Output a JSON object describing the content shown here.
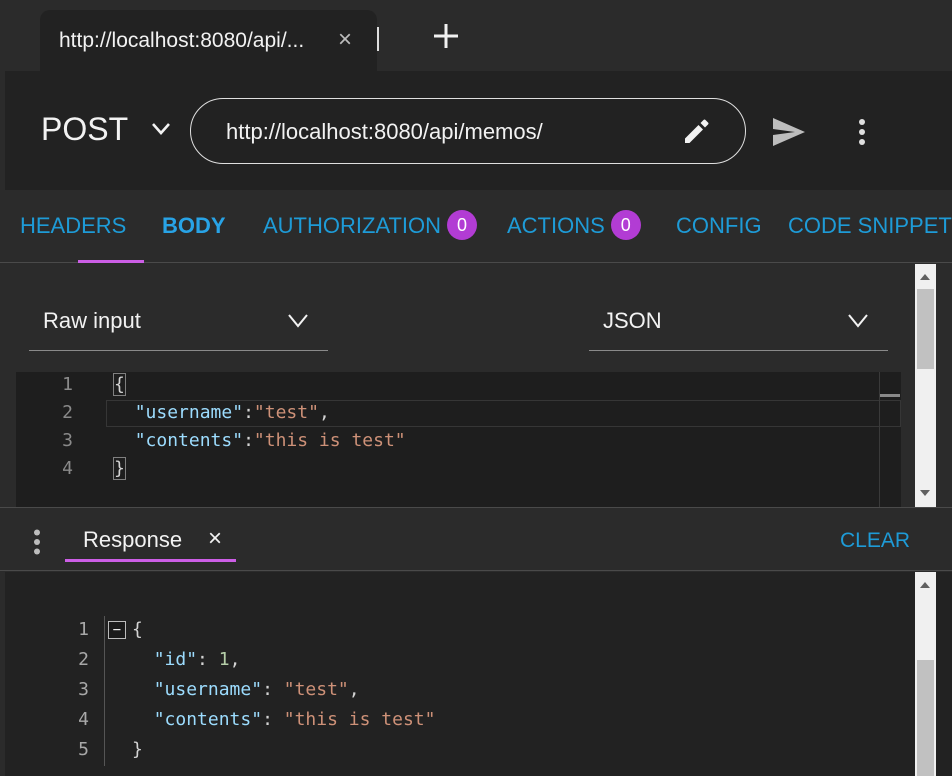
{
  "tab": {
    "title": "http://localhost:8080/api/...",
    "close": "×"
  },
  "request": {
    "method": "POST",
    "url": "http://localhost:8080/api/memos/"
  },
  "section_tabs": [
    {
      "label": "HEADERS"
    },
    {
      "label": "BODY",
      "active": true
    },
    {
      "label": "AUTHORIZATION",
      "badge": "0"
    },
    {
      "label": "ACTIONS",
      "badge": "0"
    },
    {
      "label": "CONFIG"
    },
    {
      "label": "CODE SNIPPET"
    }
  ],
  "body": {
    "input_mode": "Raw input",
    "content_type": "JSON",
    "lines": [
      {
        "num": "1",
        "text": "{"
      },
      {
        "num": "2",
        "key": "\"username\"",
        "sep": ":",
        "value": "\"test\"",
        "tail": ","
      },
      {
        "num": "3",
        "key": "\"contents\"",
        "sep": ":",
        "value": "\"this is test\"",
        "tail": ""
      },
      {
        "num": "4",
        "text": "}"
      }
    ]
  },
  "response": {
    "tab_label": "Response",
    "tab_close": "×",
    "clear_label": "CLEAR",
    "fold_symbol": "−",
    "lines": [
      {
        "num": "1",
        "text": "{"
      },
      {
        "num": "2",
        "key": "\"id\"",
        "sep": ": ",
        "value": "1",
        "value_type": "number",
        "tail": ","
      },
      {
        "num": "3",
        "key": "\"username\"",
        "sep": ": ",
        "value": "\"test\"",
        "value_type": "string",
        "tail": ","
      },
      {
        "num": "4",
        "key": "\"contents\"",
        "sep": ": ",
        "value": "\"this is test\"",
        "value_type": "string",
        "tail": ""
      },
      {
        "num": "5",
        "text": "}"
      }
    ]
  },
  "colors": {
    "accent_blue": "#1e9bd7",
    "indicator_purple": "#cc5ee6",
    "badge_purple": "#b23cd4",
    "json_key": "#9cdcfe",
    "json_string": "#ce9178",
    "json_number": "#b5cea8"
  },
  "icons": {
    "tab_close": "close-icon",
    "new_tab": "plus-icon",
    "method_dropdown": "chevron-down-icon",
    "url_edit": "pencil-icon",
    "send": "send-icon",
    "more": "more-vert-icon"
  }
}
